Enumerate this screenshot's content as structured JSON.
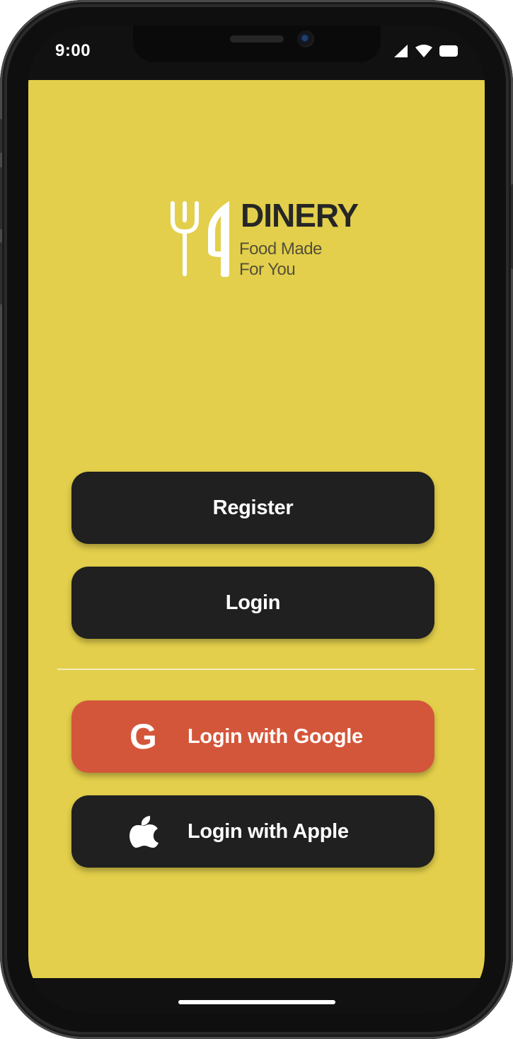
{
  "status_bar": {
    "time": "9:00",
    "icons": [
      "cellular-signal-icon",
      "wifi-icon",
      "battery-icon"
    ]
  },
  "logo": {
    "icon": "fork-knife-icon",
    "brand_name": "DINERY",
    "tagline_line1": "Food Made",
    "tagline_line2": "For You"
  },
  "actions": {
    "register_label": "Register",
    "login_label": "Login",
    "google": {
      "label": "Login with Google",
      "icon_glyph": "G",
      "icon": "google-icon"
    },
    "apple": {
      "label": "Login with Apple",
      "icon": "apple-icon"
    }
  },
  "colors": {
    "background": "#e3cf4b",
    "button_dark": "#202020",
    "button_google": "#d4563a",
    "text_light": "#ffffff",
    "brand_text": "#262626"
  }
}
